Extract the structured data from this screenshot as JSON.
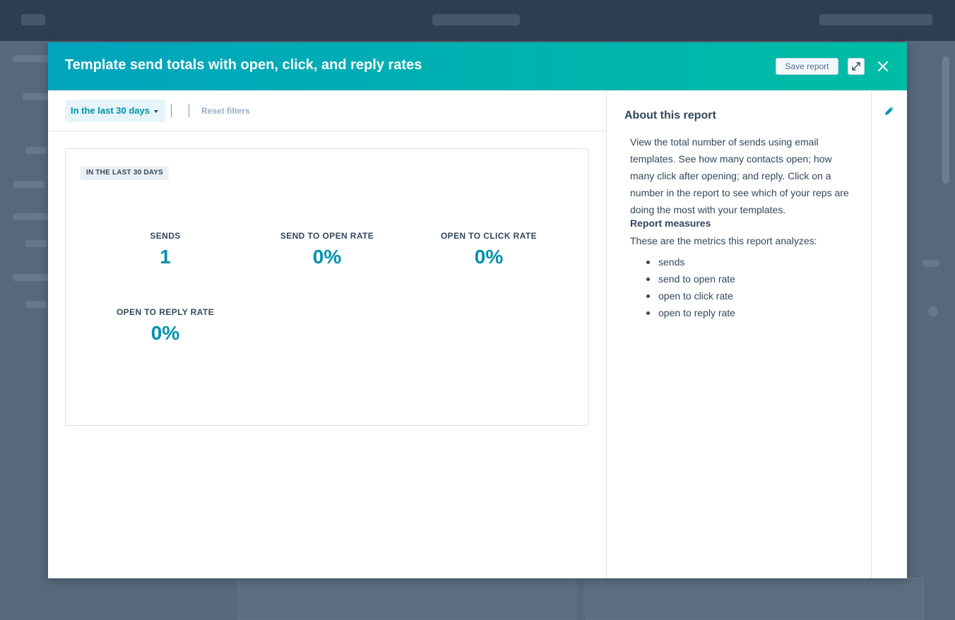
{
  "modal": {
    "title": "Template send totals with open, click, and reply rates",
    "save_label": "Save report",
    "expand_icon": "expand-icon",
    "close_icon": "close-icon"
  },
  "filters": {
    "date_range": "In the last 30 days",
    "reset_label": "Reset filters"
  },
  "report": {
    "date_tag": "IN THE LAST 30 DAYS",
    "metrics": [
      {
        "label": "SENDS",
        "value": "1"
      },
      {
        "label": "SEND TO OPEN RATE",
        "value": "0%"
      },
      {
        "label": "OPEN TO CLICK RATE",
        "value": "0%"
      },
      {
        "label": "OPEN TO REPLY RATE",
        "value": "0%"
      }
    ]
  },
  "about": {
    "title": "About this report",
    "description": "View the total number of sends using email templates. See how many contacts open; how many click after opening; and reply. Click on a number in the report to see which of your reps are doing the most with your templates.",
    "measures_title": "Report measures",
    "measures_intro": "These are the metrics this report analyzes:",
    "measures": [
      "sends",
      "send to open rate",
      "open to click rate",
      "open to reply rate"
    ],
    "edit_icon": "pencil-icon"
  },
  "colors": {
    "header_gradient_start": "#00a4bd",
    "header_gradient_end": "#00bda5",
    "metric_value": "#0091ae",
    "text": "#33475b"
  }
}
